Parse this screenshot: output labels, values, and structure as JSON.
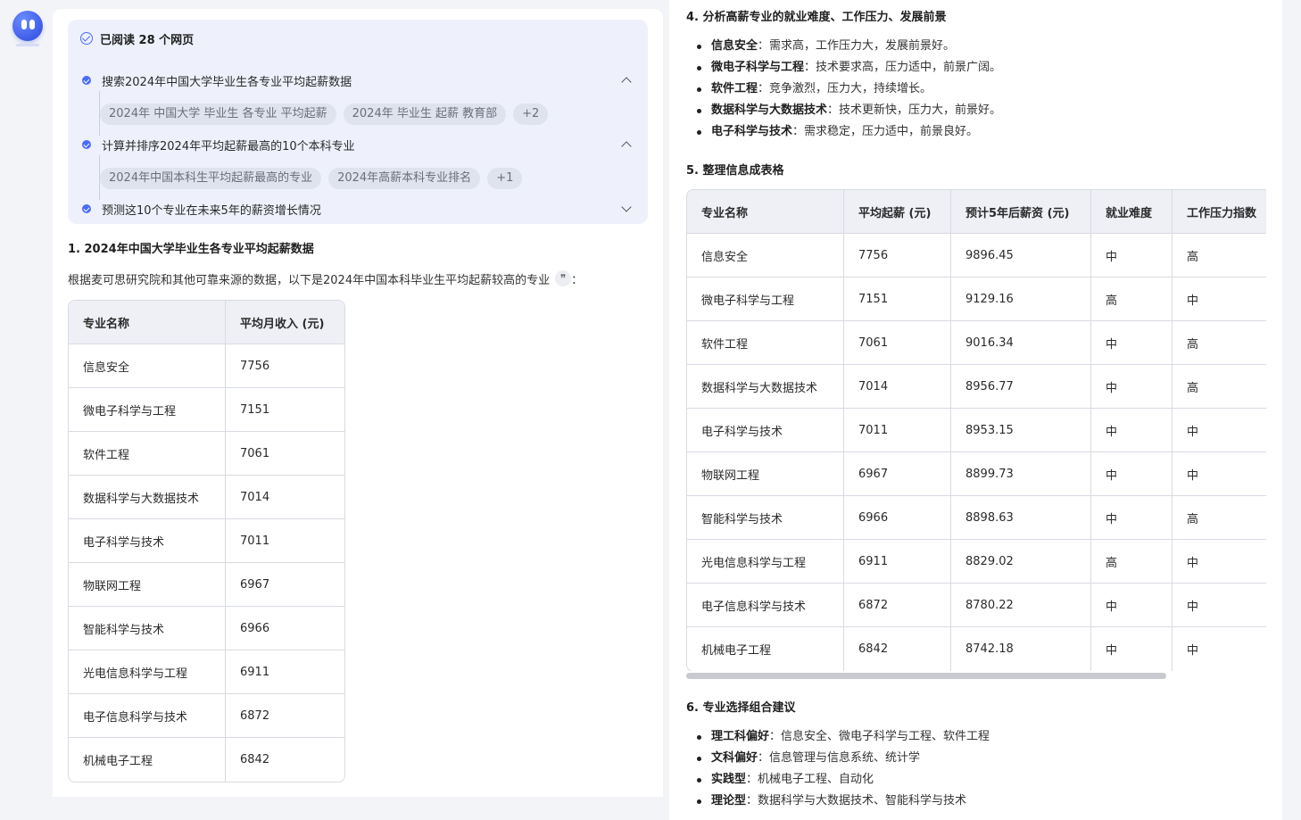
{
  "search_panel": {
    "title": "已阅读 28 个网页",
    "steps": [
      {
        "label": "搜索2024年中国大学毕业生各专业平均起薪数据",
        "chips": [
          "2024年 中国大学 毕业生 各专业 平均起薪",
          "2024年 毕业生 起薪 教育部",
          "+2"
        ]
      },
      {
        "label": "计算并排序2024年平均起薪最高的10个本科专业",
        "chips": [
          "2024年中国本科生平均起薪最高的专业",
          "2024年高薪本科专业排名",
          "+1"
        ]
      },
      {
        "label": "预测这10个专业在未来5年的薪资增长情况",
        "chips": []
      }
    ]
  },
  "section1": {
    "title": "1. 2024年中国大学毕业生各专业平均起薪数据",
    "intro": "根据麦可思研究院和其他可靠来源的数据，以下是2024年中国本科毕业生平均起薪较高的专业",
    "intro_tail": "：",
    "headers": [
      "专业名称",
      "平均月收入 (元)"
    ],
    "rows": [
      [
        "信息安全",
        "7756"
      ],
      [
        "微电子科学与工程",
        "7151"
      ],
      [
        "软件工程",
        "7061"
      ],
      [
        "数据科学与大数据技术",
        "7014"
      ],
      [
        "电子科学与技术",
        "7011"
      ],
      [
        "物联网工程",
        "6967"
      ],
      [
        "智能科学与技术",
        "6966"
      ],
      [
        "光电信息科学与工程",
        "6911"
      ],
      [
        "电子信息科学与技术",
        "6872"
      ],
      [
        "机械电子工程",
        "6842"
      ]
    ]
  },
  "section4": {
    "title": "4. 分析高薪专业的就业难度、工作压力、发展前景",
    "items": [
      {
        "name": "信息安全",
        "text": "：需求高，工作压力大，发展前景好。"
      },
      {
        "name": "微电子科学与工程",
        "text": "：技术要求高，压力适中，前景广阔。"
      },
      {
        "name": "软件工程",
        "text": "：竞争激烈，压力大，持续增长。"
      },
      {
        "name": "数据科学与大数据技术",
        "text": "：技术更新快，压力大，前景好。"
      },
      {
        "name": "电子科学与技术",
        "text": "：需求稳定，压力适中，前景良好。"
      }
    ]
  },
  "section5": {
    "title": "5. 整理信息成表格",
    "headers": [
      "专业名称",
      "平均起薪 (元)",
      "预计5年后薪资 (元)",
      "就业难度",
      "工作压力指数"
    ],
    "rows": [
      [
        "信息安全",
        "7756",
        "9896.45",
        "中",
        "高"
      ],
      [
        "微电子科学与工程",
        "7151",
        "9129.16",
        "高",
        "中"
      ],
      [
        "软件工程",
        "7061",
        "9016.34",
        "中",
        "高"
      ],
      [
        "数据科学与大数据技术",
        "7014",
        "8956.77",
        "中",
        "高"
      ],
      [
        "电子科学与技术",
        "7011",
        "8953.15",
        "中",
        "中"
      ],
      [
        "物联网工程",
        "6967",
        "8899.73",
        "中",
        "中"
      ],
      [
        "智能科学与技术",
        "6966",
        "8898.63",
        "中",
        "高"
      ],
      [
        "光电信息科学与工程",
        "6911",
        "8829.02",
        "高",
        "中"
      ],
      [
        "电子信息科学与技术",
        "6872",
        "8780.22",
        "中",
        "中"
      ],
      [
        "机械电子工程",
        "6842",
        "8742.18",
        "中",
        "中"
      ]
    ]
  },
  "section6": {
    "title": "6. 专业选择组合建议",
    "items": [
      {
        "name": "理工科偏好",
        "text": "：信息安全、微电子科学与工程、软件工程"
      },
      {
        "name": "文科偏好",
        "text": "：信息管理与信息系统、统计学"
      },
      {
        "name": "实践型",
        "text": "：机械电子工程、自动化"
      },
      {
        "name": "理论型",
        "text": "：数据科学与大数据技术、智能科学与技术"
      }
    ]
  },
  "icons": {
    "avatar": "bot-avatar-icon",
    "read": "check-circle-icon",
    "step": "step-check-icon",
    "expand": "chevron-up-icon",
    "collapse": "chevron-down-icon",
    "citation": "quote-icon"
  },
  "colors": {
    "accent": "#4a6cf7",
    "panel_bg": "#eef1fb",
    "page_bg": "#f3f4f8"
  }
}
